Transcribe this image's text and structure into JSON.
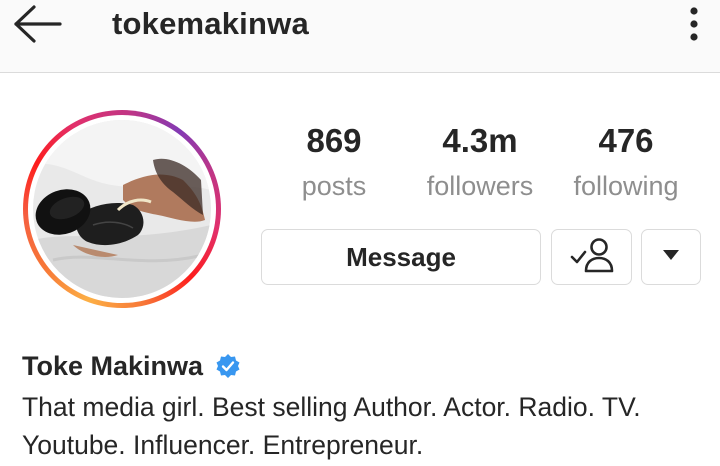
{
  "header": {
    "username": "tokemakinwa",
    "back_icon": "back-arrow-icon",
    "menu_icon": "more-vertical-icon"
  },
  "profile": {
    "avatar_icon": "profile-avatar",
    "ring_colors": [
      "#fcaf45",
      "#f77737",
      "#fd1d1d",
      "#e1306c",
      "#c13584",
      "#833ab4"
    ],
    "stats": {
      "posts": {
        "value": "869",
        "label": "posts"
      },
      "followers": {
        "value": "4.3m",
        "label": "followers"
      },
      "following": {
        "value": "476",
        "label": "following"
      }
    },
    "actions": {
      "message_label": "Message",
      "following_icon": "person-check-icon",
      "dropdown_icon": "caret-down-icon"
    },
    "name": "Toke Makinwa",
    "verified_icon": "verified-badge-icon",
    "verified_color": "#3897f0",
    "bio_line1": "That media girl. Best selling Author. Actor. Radio. TV.",
    "bio_line2": "Youtube. Influencer. Entrepreneur."
  }
}
